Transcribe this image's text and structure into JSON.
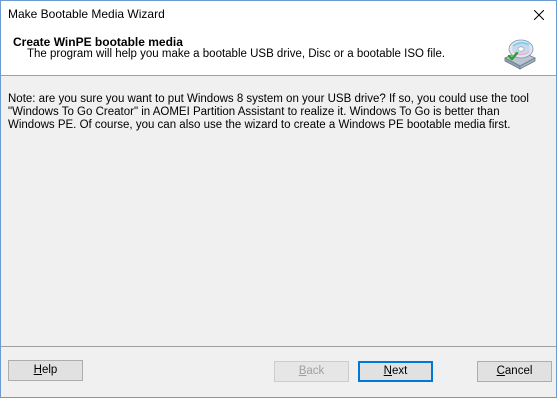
{
  "window": {
    "title": "Make Bootable Media Wizard"
  },
  "header": {
    "title": "Create WinPE bootable media",
    "subtitle": "The program will help you make a bootable USB drive, Disc or a bootable ISO file.",
    "icon": "disc-icon"
  },
  "body": {
    "note": "Note: are you sure you want to put Windows 8 system on your USB drive? If so, you could use the tool \"Windows To Go Creator\" in AOMEI Partition Assistant to realize it. Windows To Go is better than Windows PE. Of course, you can also use the wizard to create a Windows PE bootable media first."
  },
  "buttons": {
    "help": {
      "prefix": "H",
      "rest": "elp"
    },
    "back": {
      "prefix": "B",
      "rest": "ack"
    },
    "next": {
      "prefix": "N",
      "rest": "ext"
    },
    "cancel": {
      "prefix": "C",
      "rest": "ancel"
    }
  },
  "colors": {
    "accent": "#0078d7",
    "window_border": "#6d9bd1"
  }
}
